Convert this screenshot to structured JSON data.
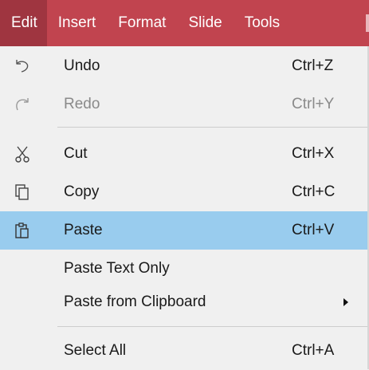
{
  "menubar": {
    "items": [
      {
        "label": "Edit"
      },
      {
        "label": "Insert"
      },
      {
        "label": "Format"
      },
      {
        "label": "Slide"
      },
      {
        "label": "Tools"
      }
    ],
    "active": "Edit"
  },
  "menu": {
    "items": [
      {
        "label": "Undo",
        "shortcut": "Ctrl+Z",
        "icon": "undo-icon",
        "enabled": true
      },
      {
        "label": "Redo",
        "shortcut": "Ctrl+Y",
        "icon": "redo-icon",
        "enabled": false
      },
      {
        "label": "Cut",
        "shortcut": "Ctrl+X",
        "icon": "cut-icon",
        "enabled": true
      },
      {
        "label": "Copy",
        "shortcut": "Ctrl+C",
        "icon": "copy-icon",
        "enabled": true
      },
      {
        "label": "Paste",
        "shortcut": "Ctrl+V",
        "icon": "paste-icon",
        "enabled": true,
        "highlighted": true
      },
      {
        "label": "Paste Text Only",
        "shortcut": "",
        "enabled": true
      },
      {
        "label": "Paste from Clipboard",
        "shortcut": "",
        "enabled": true,
        "submenu": true
      },
      {
        "label": "Select All",
        "shortcut": "Ctrl+A",
        "enabled": true
      }
    ]
  },
  "colors": {
    "menubar_bg": "#c1444f",
    "menubar_active_bg": "#9f3540",
    "menu_bg": "#f0f0f0",
    "highlight_bg": "#99ccee",
    "disabled_text": "#8a8a8a"
  }
}
